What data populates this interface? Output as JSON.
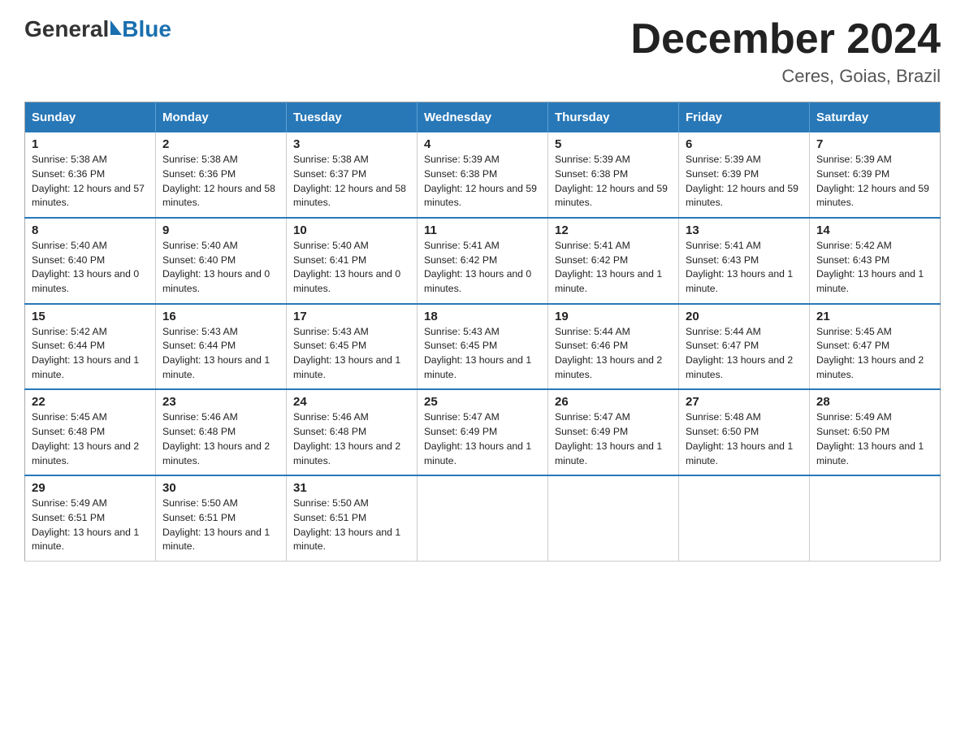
{
  "header": {
    "logo_general": "General",
    "logo_blue": "Blue",
    "month_title": "December 2024",
    "location": "Ceres, Goias, Brazil"
  },
  "days_of_week": [
    "Sunday",
    "Monday",
    "Tuesday",
    "Wednesday",
    "Thursday",
    "Friday",
    "Saturday"
  ],
  "weeks": [
    [
      {
        "day": "1",
        "sunrise": "5:38 AM",
        "sunset": "6:36 PM",
        "daylight": "12 hours and 57 minutes."
      },
      {
        "day": "2",
        "sunrise": "5:38 AM",
        "sunset": "6:36 PM",
        "daylight": "12 hours and 58 minutes."
      },
      {
        "day": "3",
        "sunrise": "5:38 AM",
        "sunset": "6:37 PM",
        "daylight": "12 hours and 58 minutes."
      },
      {
        "day": "4",
        "sunrise": "5:39 AM",
        "sunset": "6:38 PM",
        "daylight": "12 hours and 59 minutes."
      },
      {
        "day": "5",
        "sunrise": "5:39 AM",
        "sunset": "6:38 PM",
        "daylight": "12 hours and 59 minutes."
      },
      {
        "day": "6",
        "sunrise": "5:39 AM",
        "sunset": "6:39 PM",
        "daylight": "12 hours and 59 minutes."
      },
      {
        "day": "7",
        "sunrise": "5:39 AM",
        "sunset": "6:39 PM",
        "daylight": "12 hours and 59 minutes."
      }
    ],
    [
      {
        "day": "8",
        "sunrise": "5:40 AM",
        "sunset": "6:40 PM",
        "daylight": "13 hours and 0 minutes."
      },
      {
        "day": "9",
        "sunrise": "5:40 AM",
        "sunset": "6:40 PM",
        "daylight": "13 hours and 0 minutes."
      },
      {
        "day": "10",
        "sunrise": "5:40 AM",
        "sunset": "6:41 PM",
        "daylight": "13 hours and 0 minutes."
      },
      {
        "day": "11",
        "sunrise": "5:41 AM",
        "sunset": "6:42 PM",
        "daylight": "13 hours and 0 minutes."
      },
      {
        "day": "12",
        "sunrise": "5:41 AM",
        "sunset": "6:42 PM",
        "daylight": "13 hours and 1 minute."
      },
      {
        "day": "13",
        "sunrise": "5:41 AM",
        "sunset": "6:43 PM",
        "daylight": "13 hours and 1 minute."
      },
      {
        "day": "14",
        "sunrise": "5:42 AM",
        "sunset": "6:43 PM",
        "daylight": "13 hours and 1 minute."
      }
    ],
    [
      {
        "day": "15",
        "sunrise": "5:42 AM",
        "sunset": "6:44 PM",
        "daylight": "13 hours and 1 minute."
      },
      {
        "day": "16",
        "sunrise": "5:43 AM",
        "sunset": "6:44 PM",
        "daylight": "13 hours and 1 minute."
      },
      {
        "day": "17",
        "sunrise": "5:43 AM",
        "sunset": "6:45 PM",
        "daylight": "13 hours and 1 minute."
      },
      {
        "day": "18",
        "sunrise": "5:43 AM",
        "sunset": "6:45 PM",
        "daylight": "13 hours and 1 minute."
      },
      {
        "day": "19",
        "sunrise": "5:44 AM",
        "sunset": "6:46 PM",
        "daylight": "13 hours and 2 minutes."
      },
      {
        "day": "20",
        "sunrise": "5:44 AM",
        "sunset": "6:47 PM",
        "daylight": "13 hours and 2 minutes."
      },
      {
        "day": "21",
        "sunrise": "5:45 AM",
        "sunset": "6:47 PM",
        "daylight": "13 hours and 2 minutes."
      }
    ],
    [
      {
        "day": "22",
        "sunrise": "5:45 AM",
        "sunset": "6:48 PM",
        "daylight": "13 hours and 2 minutes."
      },
      {
        "day": "23",
        "sunrise": "5:46 AM",
        "sunset": "6:48 PM",
        "daylight": "13 hours and 2 minutes."
      },
      {
        "day": "24",
        "sunrise": "5:46 AM",
        "sunset": "6:48 PM",
        "daylight": "13 hours and 2 minutes."
      },
      {
        "day": "25",
        "sunrise": "5:47 AM",
        "sunset": "6:49 PM",
        "daylight": "13 hours and 1 minute."
      },
      {
        "day": "26",
        "sunrise": "5:47 AM",
        "sunset": "6:49 PM",
        "daylight": "13 hours and 1 minute."
      },
      {
        "day": "27",
        "sunrise": "5:48 AM",
        "sunset": "6:50 PM",
        "daylight": "13 hours and 1 minute."
      },
      {
        "day": "28",
        "sunrise": "5:49 AM",
        "sunset": "6:50 PM",
        "daylight": "13 hours and 1 minute."
      }
    ],
    [
      {
        "day": "29",
        "sunrise": "5:49 AM",
        "sunset": "6:51 PM",
        "daylight": "13 hours and 1 minute."
      },
      {
        "day": "30",
        "sunrise": "5:50 AM",
        "sunset": "6:51 PM",
        "daylight": "13 hours and 1 minute."
      },
      {
        "day": "31",
        "sunrise": "5:50 AM",
        "sunset": "6:51 PM",
        "daylight": "13 hours and 1 minute."
      },
      null,
      null,
      null,
      null
    ]
  ],
  "labels": {
    "sunrise": "Sunrise:",
    "sunset": "Sunset:",
    "daylight": "Daylight:"
  }
}
